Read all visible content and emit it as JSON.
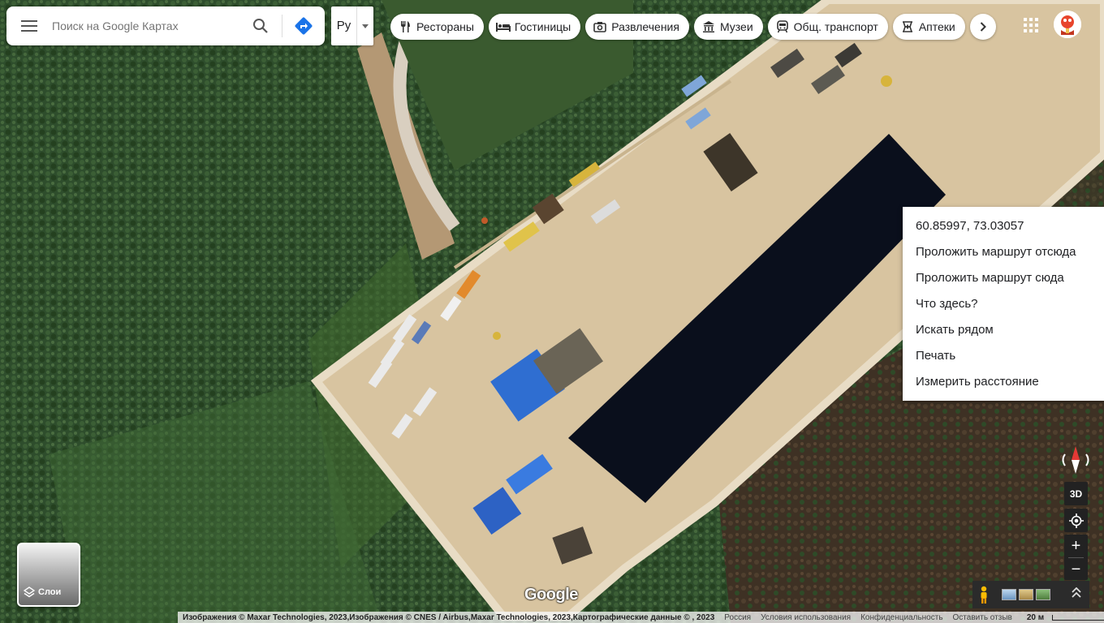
{
  "search": {
    "placeholder": "Поиск на Google Картах"
  },
  "language": {
    "label": "Ру"
  },
  "categories": [
    {
      "label": "Рестораны",
      "icon": "fork-knife-icon"
    },
    {
      "label": "Гостиницы",
      "icon": "bed-icon"
    },
    {
      "label": "Развлечения",
      "icon": "camera-icon"
    },
    {
      "label": "Музеи",
      "icon": "museum-icon"
    },
    {
      "label": "Общ. транспорт",
      "icon": "train-icon"
    },
    {
      "label": "Аптеки",
      "icon": "pharmacy-icon"
    }
  ],
  "context_menu": {
    "coordinates": "60.85997, 73.03057",
    "items": [
      "Проложить маршрут отсюда",
      "Проложить маршрут сюда",
      "Что здесь?",
      "Искать рядом",
      "Печать",
      "Измерить расстояние"
    ]
  },
  "controls": {
    "three_d": "3D",
    "zoom_in": "+",
    "zoom_out": "−"
  },
  "layers": {
    "label": "Слои"
  },
  "logo": "Google",
  "footer": {
    "attribution": "Изображения © Maxar Technologies, 2023,Изображения © CNES / Airbus,Maxar Technologies, 2023,Картографические данные © , 2023",
    "country": "Россия",
    "terms": "Условия использования",
    "privacy": "Конфиденциальность",
    "feedback": "Оставить отзыв",
    "scale": "20 м"
  },
  "colors": {
    "accent_blue": "#1a73e8",
    "forest": "#2d4f2b",
    "sand": "#d8c4a0",
    "pond": "#0a0f1c"
  }
}
